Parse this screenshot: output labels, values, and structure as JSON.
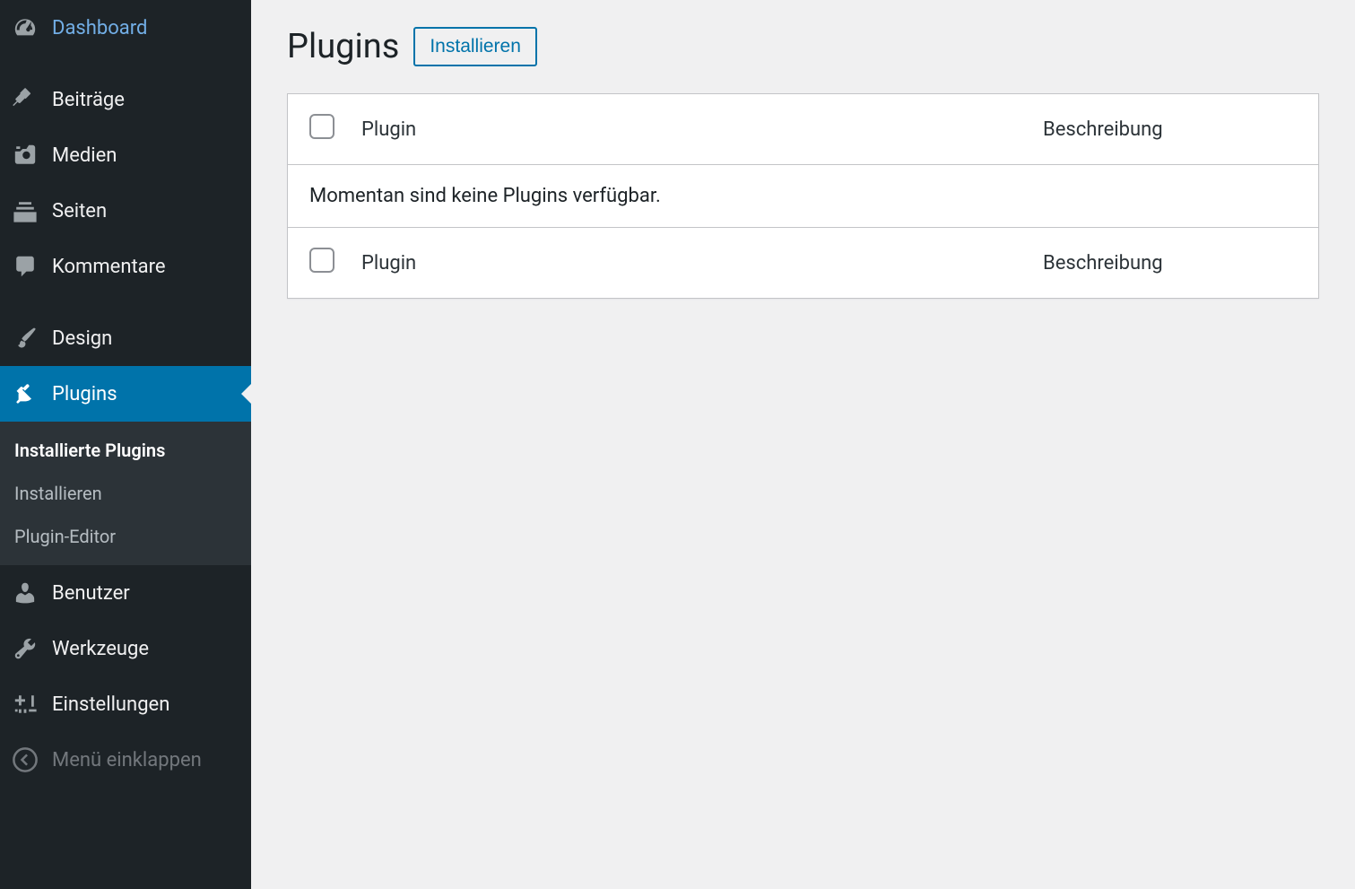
{
  "sidebar": {
    "items": [
      {
        "id": "dashboard",
        "label": "Dashboard",
        "icon": "dashboard"
      },
      {
        "id": "posts",
        "label": "Beiträge",
        "icon": "pin"
      },
      {
        "id": "media",
        "label": "Medien",
        "icon": "camera"
      },
      {
        "id": "pages",
        "label": "Seiten",
        "icon": "stack"
      },
      {
        "id": "comments",
        "label": "Kommentare",
        "icon": "comment"
      },
      {
        "id": "design",
        "label": "Design",
        "icon": "brush"
      },
      {
        "id": "plugins",
        "label": "Plugins",
        "icon": "plug"
      },
      {
        "id": "users",
        "label": "Benutzer",
        "icon": "user"
      },
      {
        "id": "tools",
        "label": "Werkzeuge",
        "icon": "wrench"
      },
      {
        "id": "settings",
        "label": "Einstellungen",
        "icon": "sliders"
      },
      {
        "id": "collapse",
        "label": "Menü einklappen",
        "icon": "collapse"
      }
    ],
    "submenu": {
      "items": [
        {
          "label": "Installierte Plugins",
          "current": true
        },
        {
          "label": "Installieren",
          "current": false
        },
        {
          "label": "Plugin-Editor",
          "current": false
        }
      ]
    }
  },
  "page": {
    "title": "Plugins",
    "action_button": "Installieren"
  },
  "table": {
    "columns": {
      "plugin": "Plugin",
      "description": "Beschreibung"
    },
    "empty_message": "Momentan sind keine Plugins verfügbar."
  }
}
